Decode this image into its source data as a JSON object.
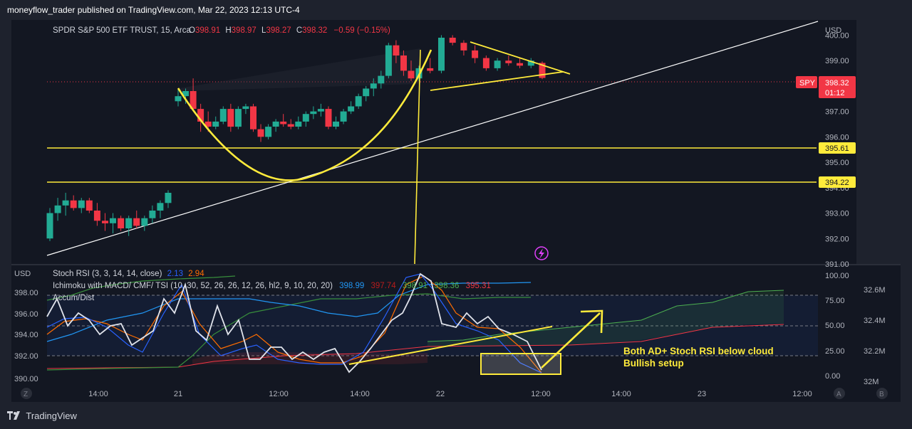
{
  "header": {
    "published": "moneyflow_trader published on TradingView.com, Mar 22, 2023 12:13 UTC-4"
  },
  "watermark": {
    "text": "TradingView"
  },
  "legend": {
    "symbol": "SPDR S&P 500 ETF TRUST, 15, Arca",
    "o_label": "O",
    "o_value": "398.91",
    "h_label": "H",
    "h_value": "398.97",
    "l_label": "L",
    "l_value": "398.27",
    "c_label": "C",
    "c_value": "398.32",
    "change": "−0.59 (−0.15%)"
  },
  "indicators": {
    "stoch_name": "Stoch RSI (3, 3, 14, 14, close)",
    "stoch_k": "2.13",
    "stoch_d": "2.94",
    "ichi_name": "Ichimoku with MACD/ CMF/ TSI (10, 30, 52, 26, 26, 12, 26, hl2, 9, 10, 20, 20)",
    "ichi_v1": "398.99",
    "ichi_v2": "397.74",
    "ichi_v3": "398.91",
    "ichi_v4": "398.36",
    "ichi_v5": "395.31",
    "ad_name": "Accum/Dist"
  },
  "price_axis": {
    "currency": "USD",
    "ticks": [
      "400.00",
      "399.00",
      "398.00",
      "397.00",
      "396.00",
      "395.00",
      "394.00",
      "393.00",
      "392.00",
      "391.00"
    ],
    "badges": {
      "symbol": "SPY",
      "last": "398.32",
      "countdown": "01:12",
      "level1": "395.61",
      "level2": "394.22"
    }
  },
  "pane2_axes": {
    "left_label": "USD",
    "left_ticks": [
      "398.00",
      "396.00",
      "394.00",
      "392.00",
      "390.00"
    ],
    "right_ticks": [
      "100.00",
      "75.00",
      "50.00",
      "25.00",
      "0.00"
    ],
    "far_right_ticks": [
      "32.6M",
      "32.4M",
      "32.2M",
      "32M"
    ]
  },
  "time_axis": {
    "labels": [
      "14:00",
      "21",
      "12:00",
      "14:00",
      "22",
      "12:00",
      "14:00",
      "23",
      "12:00"
    ]
  },
  "footer_buttons": {
    "zoom": "Z",
    "auto": "A",
    "log": "B"
  },
  "annotations": {
    "line1": "Both AD+ Stoch RSI below cloud",
    "line2": "Bullish setup"
  },
  "colors": {
    "bg": "#1e222d",
    "up": "#22ab94",
    "down": "#f23645",
    "drawing": "#ffeb3b",
    "stoch_k": "#2962ff",
    "stoch_d": "#ff6d00",
    "cloud_green": "#4caf50",
    "cloud_red": "#f23645",
    "ad": "#d1d4dc"
  },
  "chart_data": {
    "type": "candlestick",
    "ylim": [
      391.0,
      400.6
    ],
    "candles": [
      [
        392.0,
        393.2,
        391.9,
        393.0
      ],
      [
        393.0,
        393.6,
        392.7,
        393.3
      ],
      [
        393.3,
        393.8,
        392.9,
        393.5
      ],
      [
        393.5,
        393.7,
        393.1,
        393.2
      ],
      [
        393.2,
        393.6,
        393.0,
        393.5
      ],
      [
        393.5,
        393.6,
        393.0,
        393.1
      ],
      [
        393.1,
        393.4,
        392.5,
        392.7
      ],
      [
        392.7,
        393.0,
        392.3,
        392.6
      ],
      [
        392.6,
        393.0,
        392.2,
        392.8
      ],
      [
        392.8,
        392.9,
        392.3,
        392.4
      ],
      [
        392.4,
        392.9,
        392.1,
        392.8
      ],
      [
        392.8,
        393.1,
        392.4,
        392.5
      ],
      [
        392.5,
        392.9,
        392.3,
        392.8
      ],
      [
        392.8,
        393.3,
        392.6,
        393.1
      ],
      [
        393.1,
        393.5,
        392.8,
        393.4
      ],
      [
        393.4,
        393.9,
        393.2,
        393.8
      ],
      [
        397.4,
        397.9,
        397.2,
        397.6
      ],
      [
        397.6,
        397.9,
        397.3,
        397.8
      ],
      [
        397.8,
        398.3,
        397.0,
        397.1
      ],
      [
        397.1,
        397.3,
        396.2,
        396.6
      ],
      [
        396.6,
        397.0,
        396.2,
        396.4
      ],
      [
        396.4,
        396.8,
        396.3,
        396.6
      ],
      [
        396.6,
        397.2,
        396.5,
        397.1
      ],
      [
        397.1,
        397.3,
        396.2,
        396.4
      ],
      [
        396.4,
        397.2,
        396.3,
        397.1
      ],
      [
        397.1,
        397.3,
        396.9,
        397.2
      ],
      [
        397.2,
        397.3,
        396.2,
        396.3
      ],
      [
        396.3,
        396.5,
        395.8,
        396.0
      ],
      [
        396.0,
        396.5,
        395.9,
        396.4
      ],
      [
        396.4,
        396.7,
        396.2,
        396.6
      ],
      [
        396.6,
        396.9,
        396.4,
        396.5
      ],
      [
        396.5,
        396.7,
        396.3,
        396.4
      ],
      [
        396.4,
        396.8,
        396.3,
        396.6
      ],
      [
        396.6,
        397.0,
        396.4,
        396.9
      ],
      [
        396.9,
        397.2,
        396.7,
        397.0
      ],
      [
        397.0,
        397.3,
        396.8,
        397.1
      ],
      [
        397.1,
        397.2,
        396.3,
        396.4
      ],
      [
        396.4,
        396.8,
        396.3,
        396.6
      ],
      [
        396.6,
        397.1,
        396.5,
        397.0
      ],
      [
        397.0,
        397.4,
        396.9,
        397.2
      ],
      [
        397.2,
        397.7,
        397.1,
        397.6
      ],
      [
        397.6,
        398.0,
        397.4,
        397.9
      ],
      [
        397.9,
        398.3,
        397.6,
        398.1
      ],
      [
        398.1,
        398.6,
        397.9,
        398.4
      ],
      [
        398.4,
        399.7,
        398.3,
        399.6
      ],
      [
        399.6,
        399.8,
        398.9,
        399.2
      ],
      [
        399.2,
        399.4,
        398.4,
        398.6
      ],
      [
        398.6,
        399.0,
        398.2,
        398.3
      ],
      [
        398.3,
        398.8,
        398.2,
        398.7
      ],
      [
        398.7,
        399.1,
        398.5,
        398.6
      ],
      [
        398.6,
        400.0,
        398.5,
        399.9
      ],
      [
        399.9,
        400.0,
        399.6,
        399.7
      ],
      [
        399.7,
        399.8,
        399.2,
        399.4
      ],
      [
        399.4,
        399.6,
        398.9,
        399.1
      ],
      [
        399.1,
        399.2,
        398.6,
        398.7
      ],
      [
        398.7,
        399.1,
        398.6,
        399.0
      ],
      [
        399.0,
        399.2,
        398.8,
        398.9
      ],
      [
        398.9,
        399.1,
        398.7,
        398.8
      ],
      [
        398.8,
        399.1,
        398.7,
        399.0
      ],
      [
        398.91,
        398.97,
        398.27,
        398.32
      ]
    ],
    "candle_times": [
      "20 13:15",
      "20 13:30",
      "20 13:45",
      "20 14:00",
      "20 14:15",
      "20 14:30",
      "20 14:45",
      "20 15:00",
      "20 15:15",
      "20 15:30",
      "20 15:45",
      "20 16:00",
      "20 16:15",
      "20 16:30",
      "20 16:45",
      "20 17:00",
      "21 09:30",
      "21 09:45",
      "21 10:00",
      "21 10:15",
      "21 10:30",
      "21 10:45",
      "21 11:00",
      "21 11:15",
      "21 11:30",
      "21 11:45",
      "21 12:00",
      "21 12:15",
      "21 12:30",
      "21 12:45",
      "21 13:00",
      "21 13:15",
      "21 13:30",
      "21 13:45",
      "21 14:00",
      "21 14:15",
      "21 14:30",
      "21 14:45",
      "21 15:00",
      "21 15:15",
      "21 15:30",
      "21 15:45",
      "21 16:00",
      "21 16:15",
      "21 16:30",
      "21 16:45",
      "21 17:00",
      "21 17:15",
      "22 09:30",
      "22 09:45",
      "22 10:00",
      "22 10:15",
      "22 10:30",
      "22 10:45",
      "22 11:00",
      "22 11:15",
      "22 11:30",
      "22 11:45",
      "22 12:00",
      "22 12:13"
    ]
  }
}
